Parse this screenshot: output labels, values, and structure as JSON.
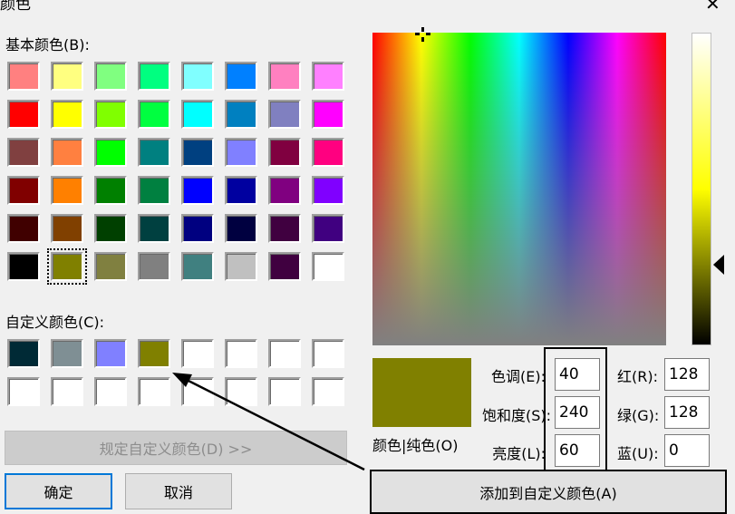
{
  "dialog": {
    "title": "颜色",
    "close_glyph": "✕"
  },
  "basic_colors": {
    "label": "基本颜色(B):",
    "rows": [
      [
        "#ff8080",
        "#ffff80",
        "#80ff80",
        "#00ff80",
        "#80ffff",
        "#0080ff",
        "#ff80c0",
        "#ff80ff"
      ],
      [
        "#ff0000",
        "#ffff00",
        "#80ff00",
        "#00ff40",
        "#00ffff",
        "#0080c0",
        "#8080c0",
        "#ff00ff"
      ],
      [
        "#804040",
        "#ff8040",
        "#00ff00",
        "#008080",
        "#004080",
        "#8080ff",
        "#800040",
        "#ff0080"
      ],
      [
        "#800000",
        "#ff8000",
        "#008000",
        "#008040",
        "#0000ff",
        "#0000a0",
        "#800080",
        "#8000ff"
      ],
      [
        "#400000",
        "#804000",
        "#004000",
        "#004040",
        "#000080",
        "#000040",
        "#400040",
        "#400080"
      ],
      [
        "#000000",
        "#808000",
        "#808040",
        "#808080",
        "#408080",
        "#c0c0c0",
        "#400040",
        "#ffffff"
      ]
    ],
    "selected_row": 5,
    "selected_col": 1
  },
  "custom_colors": {
    "label": "自定义颜色(C):",
    "rows": [
      [
        "#002a36",
        "#7f8f94",
        "#8080ff",
        "#808000",
        "#ffffff",
        "#ffffff",
        "#ffffff",
        "#ffffff"
      ],
      [
        "#ffffff",
        "#ffffff",
        "#ffffff",
        "#ffffff",
        "#ffffff",
        "#ffffff",
        "#ffffff",
        "#ffffff"
      ]
    ]
  },
  "buttons": {
    "define_custom": "规定自定义颜色(D) >>",
    "ok": "确定",
    "cancel": "取消",
    "add_custom": "添加到自定义颜色(A)"
  },
  "preview": {
    "color": "#808000",
    "label": "颜色|纯色(O)"
  },
  "hsl": {
    "hue_label": "色调(E):",
    "hue": "40",
    "sat_label": "饱和度(S):",
    "sat": "240",
    "lum_label": "亮度(L):",
    "lum": "60"
  },
  "rgb": {
    "red_label": "红(R):",
    "red": "128",
    "green_label": "绿(G):",
    "green": "128",
    "blue_label": "蓝(U):",
    "blue": "0"
  }
}
